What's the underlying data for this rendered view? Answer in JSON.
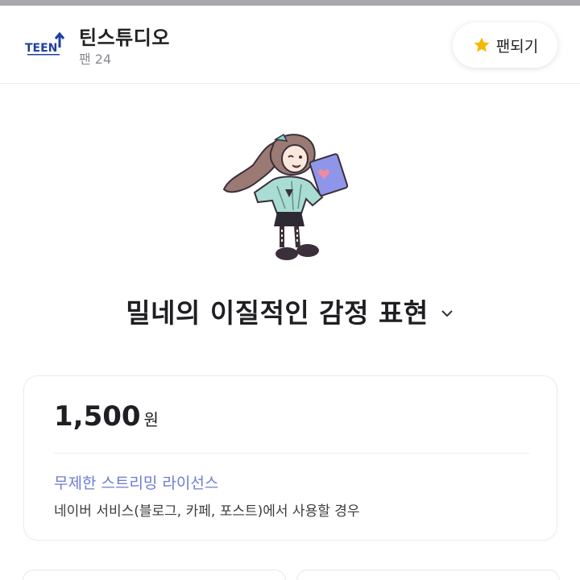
{
  "header": {
    "channel_name": "틴스튜디오",
    "fan_count": "팬 24",
    "fan_button_label": "팬되기",
    "logo_text": "TEEN",
    "star_color": "#f5b800",
    "logo_color": "#1f3fa3"
  },
  "emoticon": {
    "title": "밀네의 이질적인 감정 표현"
  },
  "price_card": {
    "price": "1,500",
    "currency": "원",
    "license_title": "무제한 스트리밍 라이선스",
    "license_desc": "네이버 서비스(블로그, 카페, 포스트)에서 사용할 경우",
    "accent_color": "#6c7bd6"
  },
  "icons": [
    "teen-logo-icon",
    "star-icon",
    "chevron-down-icon"
  ]
}
